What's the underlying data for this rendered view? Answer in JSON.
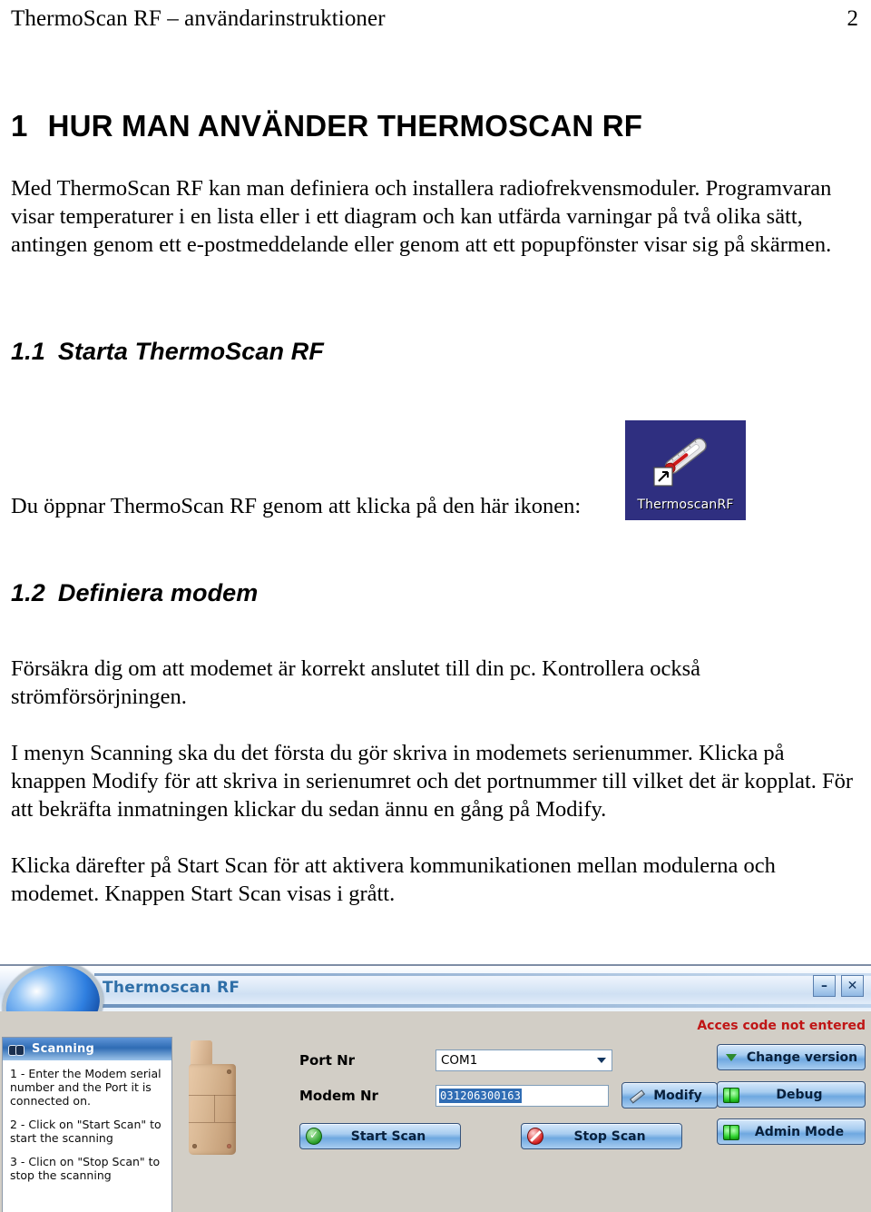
{
  "header": {
    "title": "ThermoScan RF – användarinstruktioner",
    "page_number": "2"
  },
  "document": {
    "h1": {
      "number": "1",
      "text": "HUR MAN ANVÄNDER THERMOSCAN RF"
    },
    "intro_paragraph": "Med ThermoScan RF kan man definiera och installera radiofrekvensmoduler. Programvaran visar temperaturer i en lista eller i ett diagram och kan utfärda varningar på två olika sätt, antingen genom ett e-postmeddelande eller genom att ett popupfönster visar sig på skärmen.",
    "section_1_1": {
      "number": "1.1",
      "text": "Starta ThermoScan RF"
    },
    "icon_caption": "Du öppnar ThermoScan RF genom att klicka på den här ikonen:",
    "desktop_icon_label": "ThermoscanRF",
    "section_1_2": {
      "number": "1.2",
      "text": "Definiera modem"
    },
    "paragraph_2": "Försäkra dig om att modemet är korrekt anslutet till din pc. Kontrollera också strömförsörjningen.",
    "paragraph_3": "I menyn Scanning ska du det första du gör skriva in modemets serienummer. Klicka på knappen Modify för att skriva in serienumret och det portnummer till vilket det är kopplat. För att bekräfta inmatningen klickar du sedan ännu en gång på Modify.",
    "paragraph_4": "Klicka därefter på Start Scan för att aktivera kommunikationen mellan modulerna och modemet. Knappen Start Scan visas i grått."
  },
  "app": {
    "window_title": "Thermoscan RF",
    "minimize_label": "–",
    "close_label": "✕",
    "scanning_panel": {
      "title": "Scanning",
      "steps": [
        "1 - Enter the Modem serial number and the Port it is connected on.",
        "2 - Click on \"Start Scan\" to start the scanning",
        "3 - Clicn on \"Stop Scan\" to stop the scanning"
      ]
    },
    "fields": {
      "port_label": "Port Nr",
      "port_value": "COM1",
      "modem_label": "Modem Nr",
      "modem_value": "031206300163"
    },
    "buttons": {
      "modify": "Modify",
      "start_scan": "Start Scan",
      "stop_scan": "Stop Scan",
      "change_version": "Change version",
      "debug": "Debug",
      "admin_mode": "Admin Mode"
    },
    "access_message": "Acces code not entered",
    "colors": {
      "title_text": "#2f6fa8",
      "panel_header": "#2f6cb4",
      "alert_text": "#c01515",
      "button_face": "#6ea8e0",
      "desktop_icon_bg": "#2f2f80",
      "selection": "#2f6cb4"
    }
  }
}
